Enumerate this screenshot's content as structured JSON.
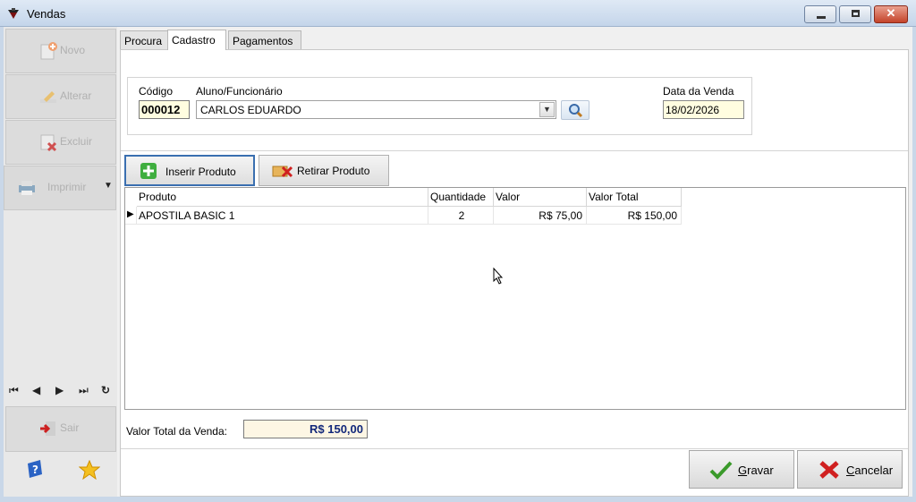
{
  "window": {
    "title": "Vendas",
    "close_glyph": "✕"
  },
  "sidebar": {
    "novo": "Novo",
    "alterar": "Alterar",
    "excluir": "Excluir",
    "imprimir": "Imprimir",
    "imprimir_arrow": "▼",
    "nav": {
      "first": "⏮",
      "prev": "◀",
      "next": "▶",
      "last": "⏭",
      "refresh": "↻"
    },
    "sair": "Sair"
  },
  "tabs": [
    "Procura",
    "Cadastro",
    "Pagamentos"
  ],
  "form": {
    "codigo_label": "Código",
    "codigo_value": "000012",
    "aluno_label": "Aluno/Funcionário",
    "aluno_value": "CARLOS EDUARDO",
    "combo_arrow": "▼",
    "data_label": "Data da Venda",
    "data_value": "18/02/2026"
  },
  "product_buttons": {
    "inserir": "Inserir Produto",
    "retirar": "Retirar Produto"
  },
  "grid": {
    "columns": [
      "Produto",
      "Quantidade",
      "Valor",
      "Valor Total"
    ],
    "row_indicator": "▶",
    "rows": [
      {
        "produto": "APOSTILA BASIC 1",
        "quantidade": "2",
        "valor": "R$ 75,00",
        "valor_total": "R$ 150,00"
      }
    ]
  },
  "total": {
    "label": "Valor Total da Venda:",
    "value": "R$ 150,00"
  },
  "actions": {
    "gravar_first": "G",
    "gravar_rest": "ravar",
    "cancelar_first": "C",
    "cancelar_rest": "ancelar"
  },
  "colors": {
    "accent_blue": "#3a6fb0",
    "total_text": "#12287a",
    "field_yellow": "#fffde0"
  }
}
